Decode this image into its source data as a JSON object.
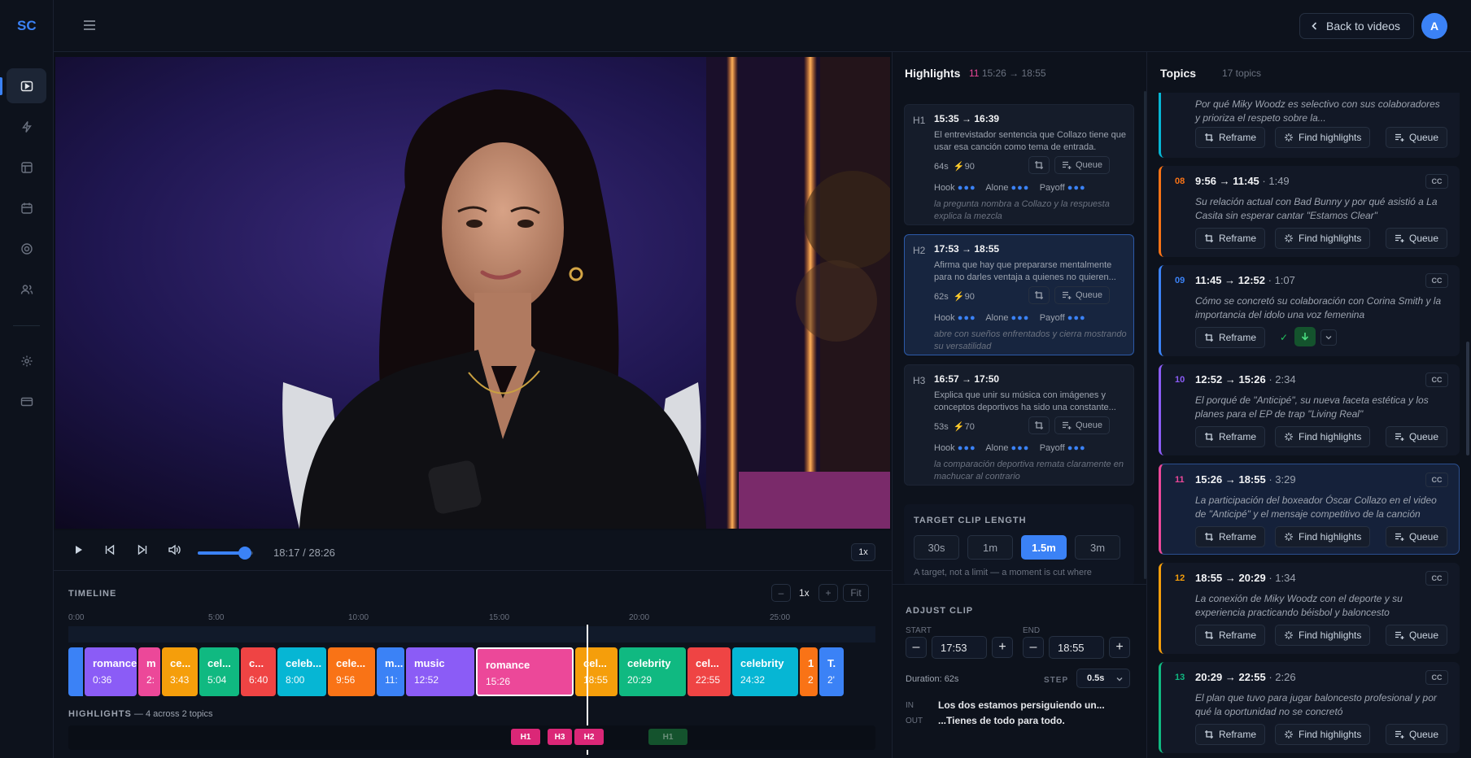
{
  "brand": {
    "logo": "SC"
  },
  "header": {
    "back_label": "Back to videos",
    "avatar_initial": "A"
  },
  "player": {
    "time": "18:17 / 28:26",
    "speed": "1x",
    "volume_fraction": 0.85
  },
  "timeline": {
    "label": "TIMELINE",
    "zoom_out": "–",
    "zoom_level": "1x",
    "zoom_in": "+",
    "fit": "Fit",
    "ruler": [
      "0:00",
      "5:00",
      "10:00",
      "15:00",
      "20:00",
      "25:00"
    ],
    "segments": [
      {
        "title": "romance",
        "time": "0:36",
        "color": "#8b5cf6"
      },
      {
        "title": "m",
        "time": "2:",
        "color": "#ec4899"
      },
      {
        "title": "ce...",
        "time": "3:43",
        "color": "#f59e0b"
      },
      {
        "title": "cel...",
        "time": "5:04",
        "color": "#10b981"
      },
      {
        "title": "c...",
        "time": "6:40",
        "color": "#ef4444"
      },
      {
        "title": "celeb...",
        "time": "8:00",
        "color": "#06b6d4"
      },
      {
        "title": "cele...",
        "time": "9:56",
        "color": "#f97316"
      },
      {
        "title": "m...",
        "time": "11:",
        "color": "#3b82f6"
      },
      {
        "title": "music",
        "time": "12:52",
        "color": "#8b5cf6"
      },
      {
        "title": "romance",
        "time": "15:26",
        "color": "#ec4899"
      },
      {
        "title": "cel...",
        "time": "18:55",
        "color": "#f59e0b"
      },
      {
        "title": "celebrity",
        "time": "20:29",
        "color": "#10b981"
      },
      {
        "title": "cel...",
        "time": "22:55",
        "color": "#ef4444"
      },
      {
        "title": "celebrity",
        "time": "24:32",
        "color": "#06b6d4"
      },
      {
        "title": "1",
        "time": "2",
        "color": "#f97316"
      },
      {
        "title": "T.",
        "time": "2'",
        "color": "#3b82f6"
      }
    ],
    "highlights_label": "HIGHLIGHTS",
    "highlights_count": "— 4 across 2 topics",
    "chips": [
      "H1",
      "H3",
      "H2",
      "H1"
    ]
  },
  "highlights": {
    "title": "Highlights",
    "count": "11",
    "range": "15:26 → 18:55",
    "items": [
      {
        "id": "H1",
        "range": "15:35 → 16:39",
        "desc": "El entrevistador sentencia que Collazo tiene que usar esa canción como tema de entrada.",
        "duration": "64s",
        "score": "90",
        "queue": "Queue",
        "hook": "Hook",
        "alone": "Alone",
        "payoff": "Payoff",
        "hook_dots": "●●●",
        "alone_dots": "●●●",
        "payoff_dots": "●●●",
        "note": "la pregunta nombra a Collazo y la respuesta explica la mezcla"
      },
      {
        "id": "H2",
        "range": "17:53 → 18:55",
        "desc": "Afirma que hay que prepararse mentalmente para no darles ventaja a quienes no quieren...",
        "duration": "62s",
        "score": "90",
        "queue": "Queue",
        "hook": "Hook",
        "alone": "Alone",
        "payoff": "Payoff",
        "hook_dots": "●●●",
        "alone_dots": "●●●",
        "payoff_dots": "●●●",
        "note": "abre con sueños enfrentados y cierra mostrando su versatilidad"
      },
      {
        "id": "H3",
        "range": "16:57 → 17:50",
        "desc": "Explica que unir su música con imágenes y conceptos deportivos ha sido una constante...",
        "duration": "53s",
        "score": "70",
        "queue": "Queue",
        "hook": "Hook",
        "alone": "Alone",
        "payoff": "Payoff",
        "hook_dots": "●●●",
        "alone_dots": "●●●",
        "payoff_dots": "●●●",
        "note": "la comparación deportiva remata claramente en machucar al contrario"
      }
    ],
    "target_label": "TARGET CLIP LENGTH",
    "lengths": [
      "30s",
      "1m",
      "1.5m",
      "3m"
    ],
    "length_selected": "1.5m",
    "target_hint": "A target, not a limit — a moment is cut where"
  },
  "adjust": {
    "label": "ADJUST CLIP",
    "start_label": "START",
    "end_label": "END",
    "start": "17:53",
    "end": "18:55",
    "minus": "–",
    "plus": "+",
    "duration": "Duration: 62s",
    "step_label": "STEP",
    "step": "0.5s",
    "in_label": "IN",
    "out_label": "OUT",
    "in_text": "Los dos estamos persiguiendo un...",
    "out_text": "...Tienes de todo para todo."
  },
  "topics": {
    "title": "Topics",
    "count": "17 topics",
    "reframe": "Reframe",
    "find": "Find highlights",
    "queue": "Queue",
    "cc": "CC",
    "top_partial": {
      "desc": "Por qué Miky Woodz es selectivo con sus colaboradores y prioriza el respeto sobre la...",
      "color": "#06b6d4"
    },
    "items": [
      {
        "num": "08",
        "range": "9:56 → 11:45",
        "dur": "· 1:49",
        "desc": "Su relación actual con Bad Bunny y por qué asistió a La Casita sin esperar cantar \"Estamos Clear\"",
        "color": "#f97316"
      },
      {
        "num": "09",
        "range": "11:45 → 12:52",
        "dur": "· 1:07",
        "desc": "Cómo se concretó su colaboración con Corina Smith y la importancia del idolo una voz femenina",
        "color": "#3b82f6"
      },
      {
        "num": "10",
        "range": "12:52 → 15:26",
        "dur": "· 2:34",
        "desc": "El porqué de \"Anticipé\", su nueva faceta estética y los planes para el EP de trap \"Living Real\"",
        "color": "#8b5cf6"
      },
      {
        "num": "11",
        "range": "15:26 → 18:55",
        "dur": "· 3:29",
        "desc": "La participación del boxeador Óscar Collazo en el video de \"Anticipé\" y el mensaje competitivo de la canción",
        "color": "#ec4899"
      },
      {
        "num": "12",
        "range": "18:55 → 20:29",
        "dur": "· 1:34",
        "desc": "La conexión de Miky Woodz con el deporte y su experiencia practicando béisbol y baloncesto",
        "color": "#f59e0b"
      },
      {
        "num": "13",
        "range": "20:29 → 22:55",
        "dur": "· 2:26",
        "desc": "El plan que tuvo para jugar baloncesto profesional y por qué la oportunidad no se concretó",
        "color": "#10b981"
      }
    ]
  }
}
